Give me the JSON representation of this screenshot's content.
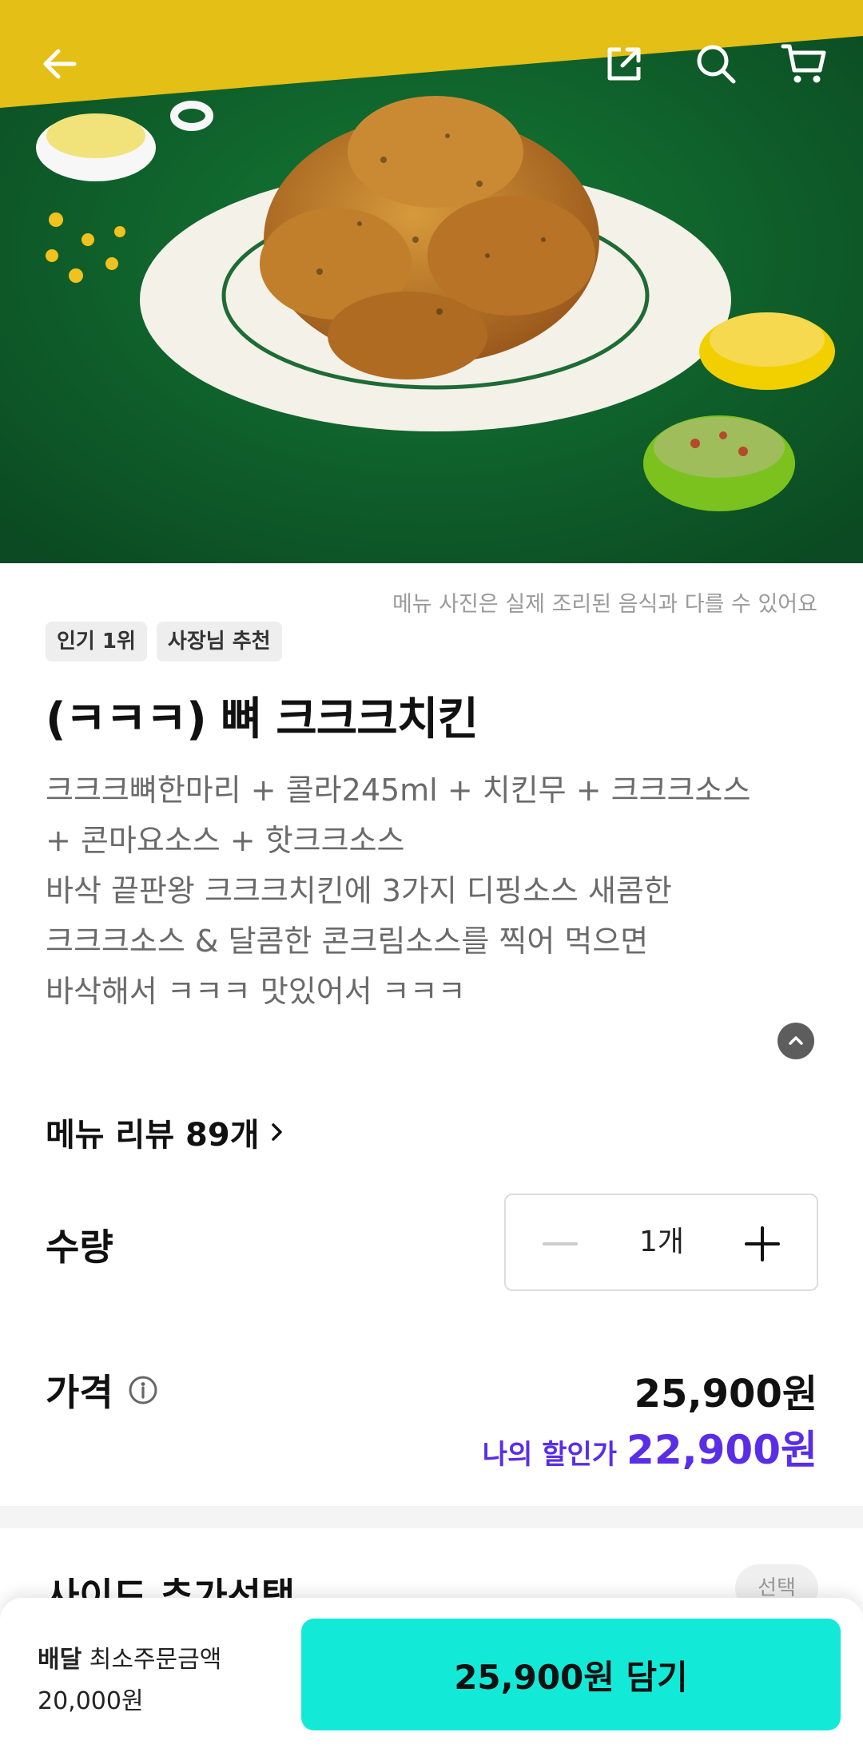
{
  "header": {
    "back_icon": "arrow-left-icon",
    "share_icon": "share-icon",
    "search_icon": "search-icon",
    "cart_icon": "cart-icon"
  },
  "disclaimer": "메뉴 사진은 실제 조리된 음식과 다를 수 있어요",
  "tags": [
    "인기 1위",
    "사장님 추천"
  ],
  "title": "(ㅋㅋㅋ) 뼈 크크크치킨",
  "description_lines": [
    "크크크뼈한마리 + 콜라245ml + 치킨무 + 크크크소스",
    "+ 콘마요소스 + 핫크크소스",
    "바삭 끝판왕 크크크치킨에 3가지 디핑소스 새콤한",
    "크크크소스 & 달콤한 콘크림소스를 찍어 먹으면",
    "바삭해서 ㅋㅋㅋ 맛있어서 ㅋㅋㅋ"
  ],
  "review_link": "메뉴 리뷰 89개",
  "quantity": {
    "label": "수량",
    "value": "1개"
  },
  "price": {
    "label": "가격",
    "amount": "25,900원",
    "discount_label": "나의 할인가",
    "discount_amount": "22,900원"
  },
  "side_section": {
    "title": "사이드 추가선택",
    "badge": "선택"
  },
  "bottom_bar": {
    "delivery_label": "배달",
    "min_order_label": "최소주문금액",
    "min_order_value": "20,000원",
    "cta": "25,900원 담기"
  },
  "colors": {
    "accent_purple": "#5a2ee6",
    "cta_mint": "#12ead7",
    "hero_green": "#0f5a2a",
    "hero_yellow": "#e4bf16"
  }
}
